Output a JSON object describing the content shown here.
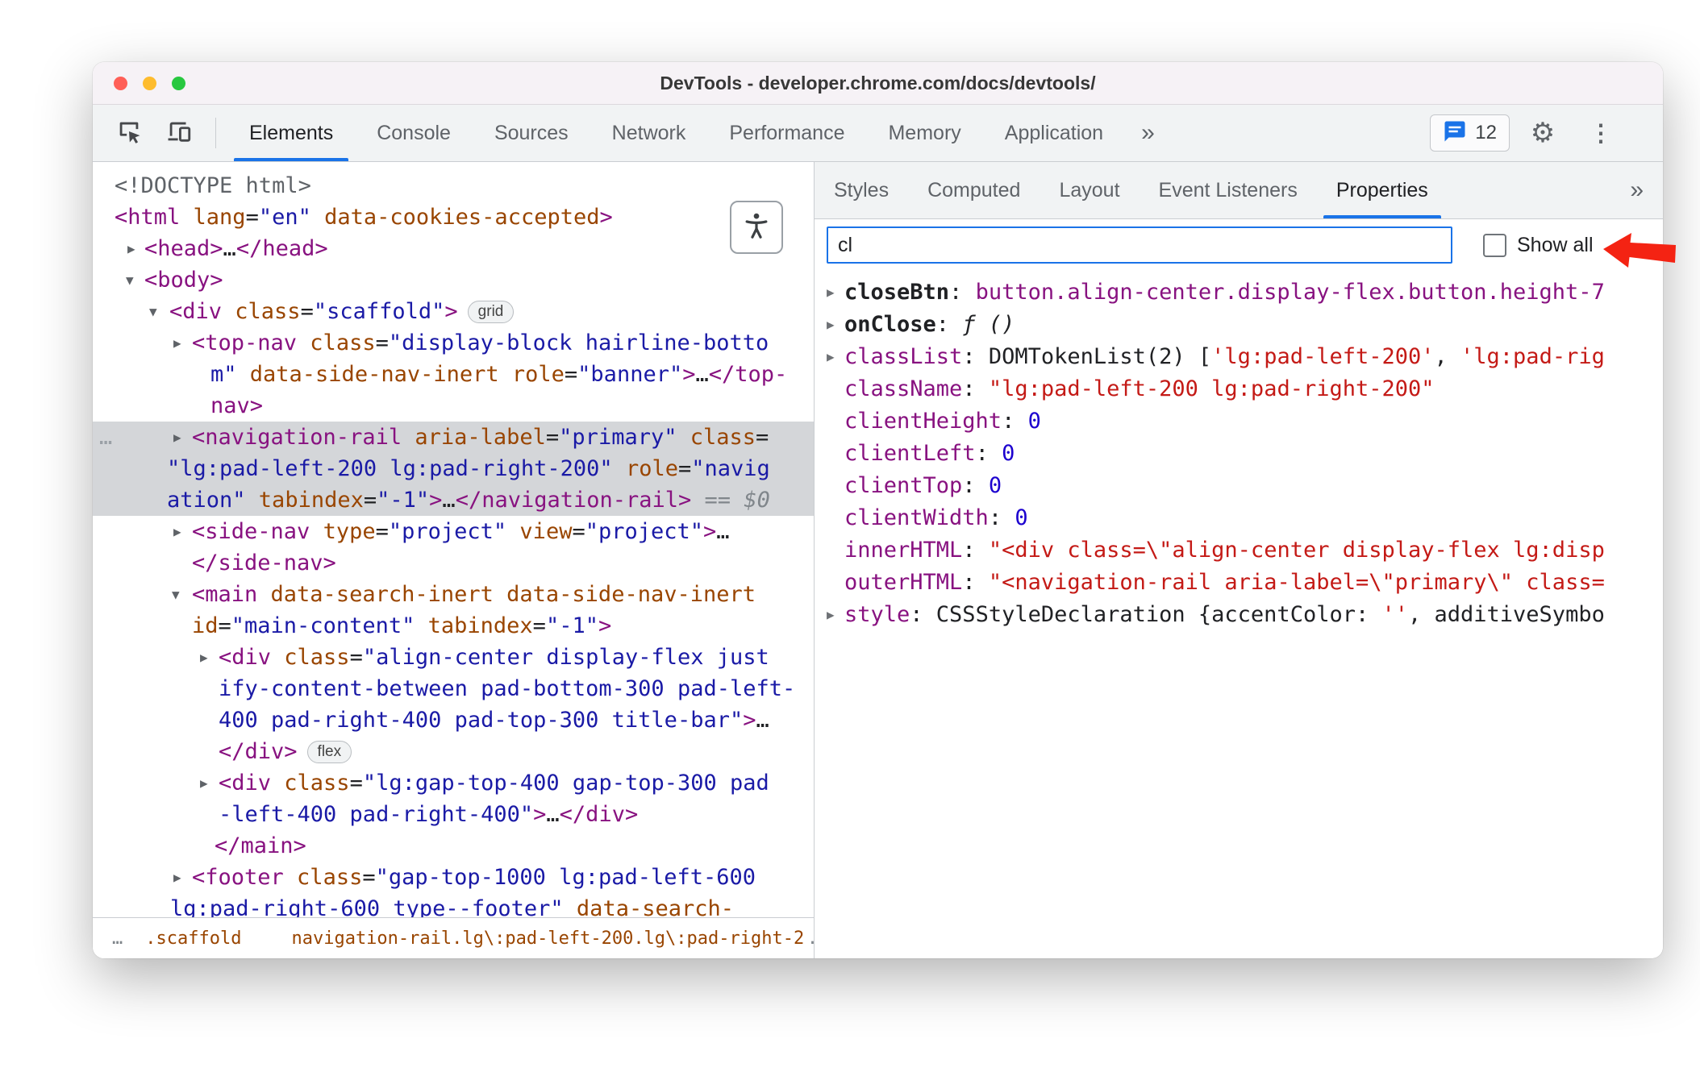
{
  "window": {
    "title": "DevTools - developer.chrome.com/docs/devtools/"
  },
  "colors": {
    "accent_blue": "#1a73e8",
    "annotation_red": "#f42313",
    "selection_gray": "#d4d6d9",
    "toolbar_gray": "#f1f3f4"
  },
  "toolbar": {
    "tabs": [
      "Elements",
      "Console",
      "Sources",
      "Network",
      "Performance",
      "Memory",
      "Application"
    ],
    "selected_tab": "Elements",
    "overflow_icon": "»",
    "issues_count": "12",
    "settings_icon": "⚙",
    "menu_icon": "⋮"
  },
  "elements": {
    "tree": [
      {
        "indent": 27,
        "segs": [
          {
            "t": "<!DOCTYPE html>",
            "c": "gray"
          }
        ]
      },
      {
        "indent": 27,
        "segs": [
          {
            "t": "<html",
            "c": "tag"
          },
          {
            "t": " lang",
            "c": "attr"
          },
          {
            "t": "=",
            "c": "plain"
          },
          {
            "t": "\"en\"",
            "c": "val"
          },
          {
            "t": " data-cookies-accepted",
            "c": "attr"
          },
          {
            "t": ">",
            "c": "tag"
          }
        ]
      },
      {
        "indent": 64,
        "arrow": "r",
        "arrowX": 43,
        "segs": [
          {
            "t": "<head>",
            "c": "tag"
          },
          {
            "t": "…",
            "c": "plain"
          },
          {
            "t": "</head>",
            "c": "tag"
          }
        ]
      },
      {
        "indent": 64,
        "arrow": "d",
        "arrowX": 41,
        "segs": [
          {
            "t": "<body>",
            "c": "tag"
          }
        ]
      },
      {
        "indent": 95,
        "arrow": "d",
        "arrowX": 70,
        "badge": "grid",
        "segs": [
          {
            "t": "<div",
            "c": "tag"
          },
          {
            "t": " class",
            "c": "attr"
          },
          {
            "t": "=",
            "c": "plain"
          },
          {
            "t": "\"scaffold\"",
            "c": "val"
          },
          {
            "t": ">",
            "c": "tag"
          }
        ]
      },
      {
        "indent": 123,
        "arrow": "r",
        "arrowX": 100,
        "segs": [
          {
            "t": "<top-nav",
            "c": "tag"
          },
          {
            "t": " class",
            "c": "attr"
          },
          {
            "t": "=",
            "c": "plain"
          },
          {
            "t": "\"display-block hairline-botto",
            "c": "val"
          }
        ]
      },
      {
        "indent": 146,
        "segs": [
          {
            "t": "m\"",
            "c": "val"
          },
          {
            "t": " data-side-nav-inert",
            "c": "attr"
          },
          {
            "t": " role",
            "c": "attr"
          },
          {
            "t": "=",
            "c": "plain"
          },
          {
            "t": "\"banner\"",
            "c": "val"
          },
          {
            "t": ">",
            "c": "tag"
          },
          {
            "t": "…",
            "c": "plain"
          },
          {
            "t": "</top-",
            "c": "tag"
          }
        ]
      },
      {
        "indent": 146,
        "segs": [
          {
            "t": "nav>",
            "c": "tag"
          }
        ]
      },
      {
        "indent": 123,
        "arrow": "r",
        "arrowX": 100,
        "selected": true,
        "gutter": "…",
        "segs": [
          {
            "t": "<navigation-rail",
            "c": "tag"
          },
          {
            "t": " aria-label",
            "c": "attr"
          },
          {
            "t": "=",
            "c": "plain"
          },
          {
            "t": "\"primary\"",
            "c": "val"
          },
          {
            "t": " class",
            "c": "attr"
          },
          {
            "t": "=",
            "c": "plain"
          }
        ]
      },
      {
        "indent": 92,
        "selected": true,
        "segs": [
          {
            "t": "\"lg:pad-left-200 lg:pad-right-200\"",
            "c": "val"
          },
          {
            "t": " role",
            "c": "attr"
          },
          {
            "t": "=",
            "c": "plain"
          },
          {
            "t": "\"navig",
            "c": "val"
          }
        ]
      },
      {
        "indent": 92,
        "selected": true,
        "segs": [
          {
            "t": "ation\"",
            "c": "val"
          },
          {
            "t": " tabindex",
            "c": "attr"
          },
          {
            "t": "=",
            "c": "plain"
          },
          {
            "t": "\"-1\"",
            "c": "val"
          },
          {
            "t": ">",
            "c": "tag"
          },
          {
            "t": "…",
            "c": "plain"
          },
          {
            "t": "</navigation-rail>",
            "c": "tag"
          },
          {
            "t": " == $0",
            "c": "eq"
          }
        ]
      },
      {
        "indent": 123,
        "arrow": "r",
        "arrowX": 100,
        "segs": [
          {
            "t": "<side-nav",
            "c": "tag"
          },
          {
            "t": " type",
            "c": "attr"
          },
          {
            "t": "=",
            "c": "plain"
          },
          {
            "t": "\"project\"",
            "c": "val"
          },
          {
            "t": " view",
            "c": "attr"
          },
          {
            "t": "=",
            "c": "plain"
          },
          {
            "t": "\"project\"",
            "c": "val"
          },
          {
            "t": ">",
            "c": "tag"
          },
          {
            "t": "…",
            "c": "plain"
          }
        ]
      },
      {
        "indent": 123,
        "segs": [
          {
            "t": "</side-nav>",
            "c": "tag"
          }
        ]
      },
      {
        "indent": 123,
        "arrow": "d",
        "arrowX": 98,
        "segs": [
          {
            "t": "<main",
            "c": "tag"
          },
          {
            "t": " data-search-inert",
            "c": "attr"
          },
          {
            "t": " data-side-nav-inert",
            "c": "attr"
          }
        ]
      },
      {
        "indent": 123,
        "segs": [
          {
            "t": "id",
            "c": "attr"
          },
          {
            "t": "=",
            "c": "plain"
          },
          {
            "t": "\"main-content\"",
            "c": "val"
          },
          {
            "t": " tabindex",
            "c": "attr"
          },
          {
            "t": "=",
            "c": "plain"
          },
          {
            "t": "\"-1\"",
            "c": "val"
          },
          {
            "t": ">",
            "c": "tag"
          }
        ]
      },
      {
        "indent": 156,
        "arrow": "r",
        "arrowX": 133,
        "segs": [
          {
            "t": "<div",
            "c": "tag"
          },
          {
            "t": " class",
            "c": "attr"
          },
          {
            "t": "=",
            "c": "plain"
          },
          {
            "t": "\"align-center display-flex just",
            "c": "val"
          }
        ]
      },
      {
        "indent": 156,
        "segs": [
          {
            "t": "ify-content-between pad-bottom-300 pad-left-",
            "c": "val"
          }
        ]
      },
      {
        "indent": 156,
        "segs": [
          {
            "t": "400 pad-right-400 pad-top-300 title-bar\"",
            "c": "val"
          },
          {
            "t": ">",
            "c": "tag"
          },
          {
            "t": "…",
            "c": "plain"
          }
        ]
      },
      {
        "indent": 156,
        "badge": "flex",
        "segs": [
          {
            "t": "</div>",
            "c": "tag"
          }
        ]
      },
      {
        "indent": 156,
        "arrow": "r",
        "arrowX": 133,
        "segs": [
          {
            "t": "<div",
            "c": "tag"
          },
          {
            "t": " class",
            "c": "attr"
          },
          {
            "t": "=",
            "c": "plain"
          },
          {
            "t": "\"lg:gap-top-400 gap-top-300 pad",
            "c": "val"
          }
        ]
      },
      {
        "indent": 156,
        "segs": [
          {
            "t": "-left-400 pad-right-400\"",
            "c": "val"
          },
          {
            "t": ">",
            "c": "tag"
          },
          {
            "t": "…",
            "c": "plain"
          },
          {
            "t": "</div>",
            "c": "tag"
          }
        ]
      },
      {
        "indent": 151,
        "segs": [
          {
            "t": "</main>",
            "c": "tag"
          }
        ]
      },
      {
        "indent": 123,
        "arrow": "r",
        "arrowX": 100,
        "segs": [
          {
            "t": "<footer",
            "c": "tag"
          },
          {
            "t": " class",
            "c": "attr"
          },
          {
            "t": "=",
            "c": "plain"
          },
          {
            "t": "\"gap-top-1000 lg:pad-left-600",
            "c": "val"
          }
        ]
      },
      {
        "indent": 96,
        "segs": [
          {
            "t": "lg:pad-right-600 type--footer\"",
            "c": "val"
          },
          {
            "t": " data-search-",
            "c": "attr"
          }
        ]
      }
    ],
    "breadcrumbs": {
      "leading": "…",
      "crumbs": [
        ".scaffold",
        "navigation-rail.lg\\:pad-left-200.lg\\:pad-right-2"
      ],
      "trailing": "…"
    }
  },
  "sidebar": {
    "tabs": [
      "Styles",
      "Computed",
      "Layout",
      "Event Listeners",
      "Properties"
    ],
    "selected_tab": "Properties",
    "overflow_icon": "»",
    "filter_value": "cl",
    "show_all_label": "Show all",
    "show_all_checked": false,
    "properties": [
      {
        "expand": true,
        "bold": true,
        "name": "closeBtn",
        "parts": [
          {
            "t": "button.align-center.display-flex.button.height-7",
            "c": "node"
          }
        ]
      },
      {
        "expand": true,
        "bold": true,
        "name": "onClose",
        "parts": [
          {
            "t": "ƒ ()",
            "c": "func"
          }
        ]
      },
      {
        "expand": true,
        "name": "classList",
        "parts": [
          {
            "t": "DOMTokenList(2) [",
            "c": "plain"
          },
          {
            "t": "'lg:pad-left-200'",
            "c": "str"
          },
          {
            "t": ", ",
            "c": "plain"
          },
          {
            "t": "'lg:pad-rig",
            "c": "str"
          }
        ]
      },
      {
        "name": "className",
        "parts": [
          {
            "t": "\"lg:pad-left-200 lg:pad-right-200\"",
            "c": "str"
          }
        ]
      },
      {
        "name": "clientHeight",
        "parts": [
          {
            "t": "0",
            "c": "num"
          }
        ]
      },
      {
        "name": "clientLeft",
        "parts": [
          {
            "t": "0",
            "c": "num"
          }
        ]
      },
      {
        "name": "clientTop",
        "parts": [
          {
            "t": "0",
            "c": "num"
          }
        ]
      },
      {
        "name": "clientWidth",
        "parts": [
          {
            "t": "0",
            "c": "num"
          }
        ]
      },
      {
        "name": "innerHTML",
        "parts": [
          {
            "t": "\"<div class=\\\"align-center display-flex lg:disp",
            "c": "str"
          }
        ]
      },
      {
        "name": "outerHTML",
        "parts": [
          {
            "t": "\"<navigation-rail aria-label=\\\"primary\\\" class=",
            "c": "str"
          }
        ]
      },
      {
        "expand": true,
        "name": "style",
        "parts": [
          {
            "t": "CSSStyleDeclaration {accentColor: ",
            "c": "plain"
          },
          {
            "t": "''",
            "c": "str"
          },
          {
            "t": ", additiveSymbo",
            "c": "plain"
          }
        ]
      }
    ]
  }
}
